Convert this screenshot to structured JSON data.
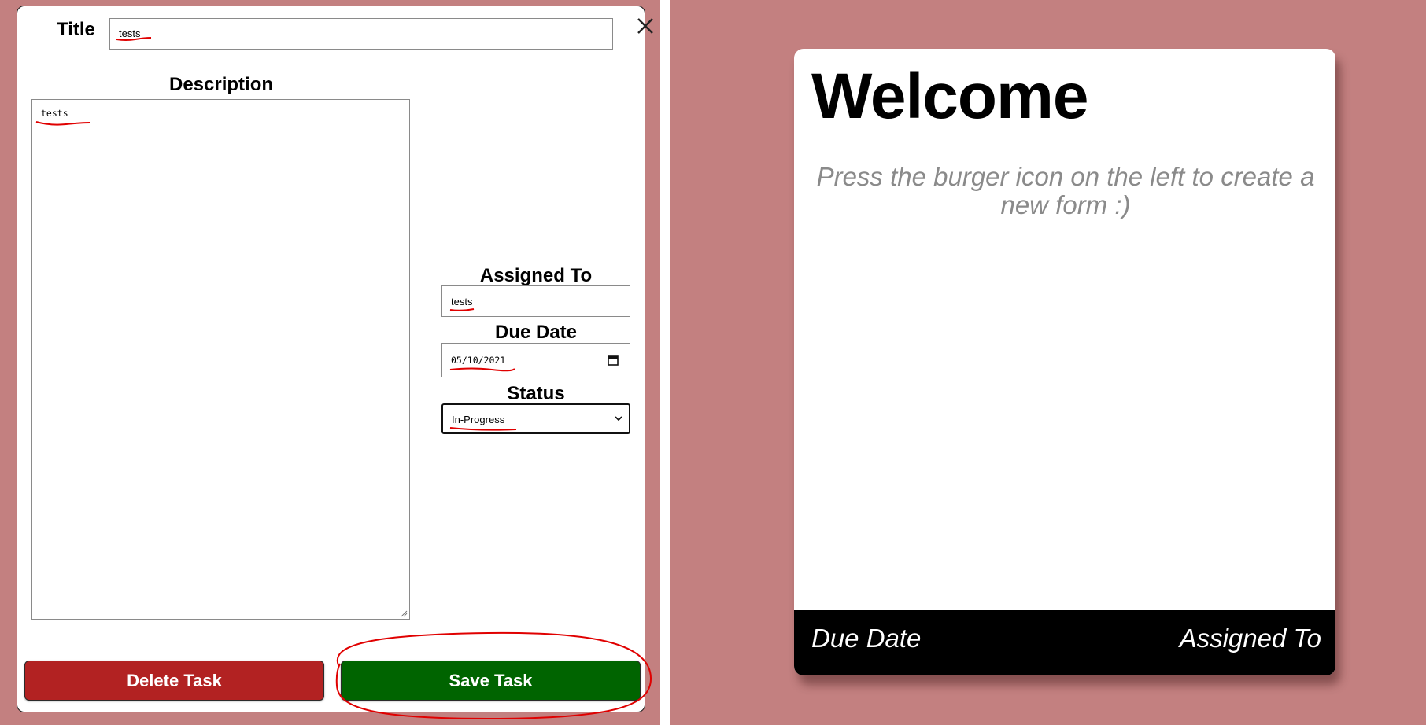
{
  "task_form": {
    "title_label": "Title",
    "title_value": "tests",
    "description_label": "Description",
    "description_value": "tests",
    "assigned_label": "Assigned To",
    "assigned_value": "tests",
    "due_label": "Due Date",
    "due_value": "05/10/2021",
    "status_label": "Status",
    "status_value": "In-Progress",
    "delete_label": "Delete Task",
    "save_label": "Save Task",
    "close_icon": "close-icon",
    "calendar_icon": "calendar-icon",
    "chevron_icon": "chevron-down-icon"
  },
  "welcome_card": {
    "title": "Welcome",
    "subtitle": "Press the burger icon on the left to create a new form :)",
    "footer_left": "Due Date",
    "footer_right": "Assigned To"
  },
  "colors": {
    "page_background": "#c38080",
    "delete_button": "#b22222",
    "save_button": "#006400",
    "annotation": "#e00000",
    "footer": "#000000"
  }
}
